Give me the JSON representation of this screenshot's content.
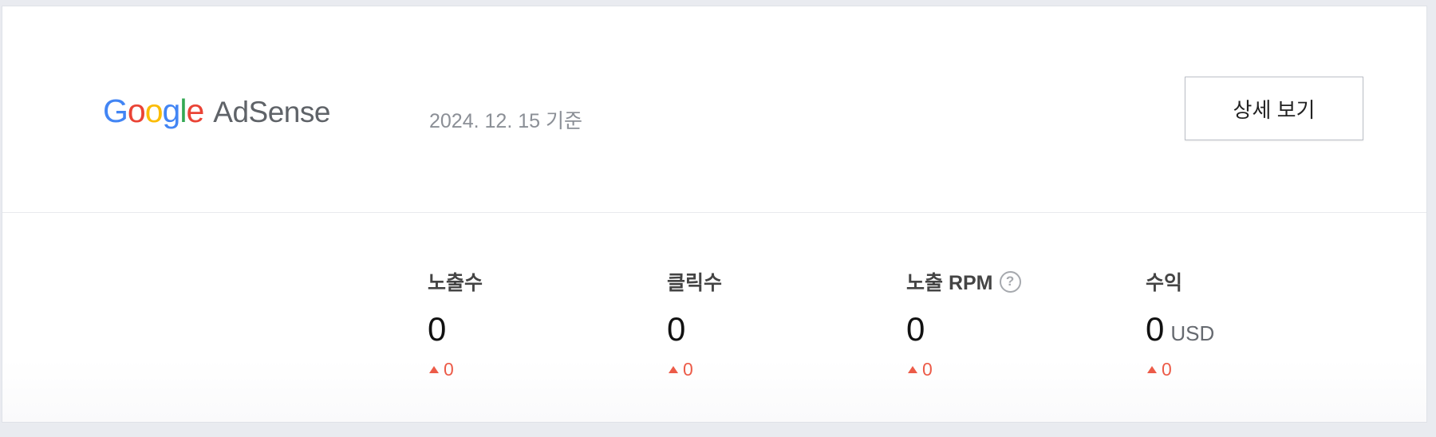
{
  "header": {
    "logo": {
      "google": [
        "G",
        "o",
        "o",
        "g",
        "l",
        "e"
      ],
      "google_colors": [
        "#4285F4",
        "#EA4335",
        "#FBBC05",
        "#4285F4",
        "#34A853",
        "#EA4335"
      ],
      "product": "AdSense"
    },
    "as_of": "2024. 12. 15 기준",
    "detail_button": "상세 보기"
  },
  "stats": [
    {
      "label": "노출수",
      "value": "0",
      "unit": "",
      "change": "0",
      "trend": "up"
    },
    {
      "label": "클릭수",
      "value": "0",
      "unit": "",
      "change": "0",
      "trend": "up"
    },
    {
      "label": "노출 RPM",
      "value": "0",
      "unit": "",
      "change": "0",
      "trend": "up",
      "help": "?"
    },
    {
      "label": "수익",
      "value": "0",
      "unit": "USD",
      "change": "0",
      "trend": "up"
    }
  ],
  "colors": {
    "trend_up": "#ec5b48",
    "text_muted": "#8b8f96"
  },
  "icons": {
    "help": "question-circle-icon",
    "trend": "triangle-up-icon"
  }
}
